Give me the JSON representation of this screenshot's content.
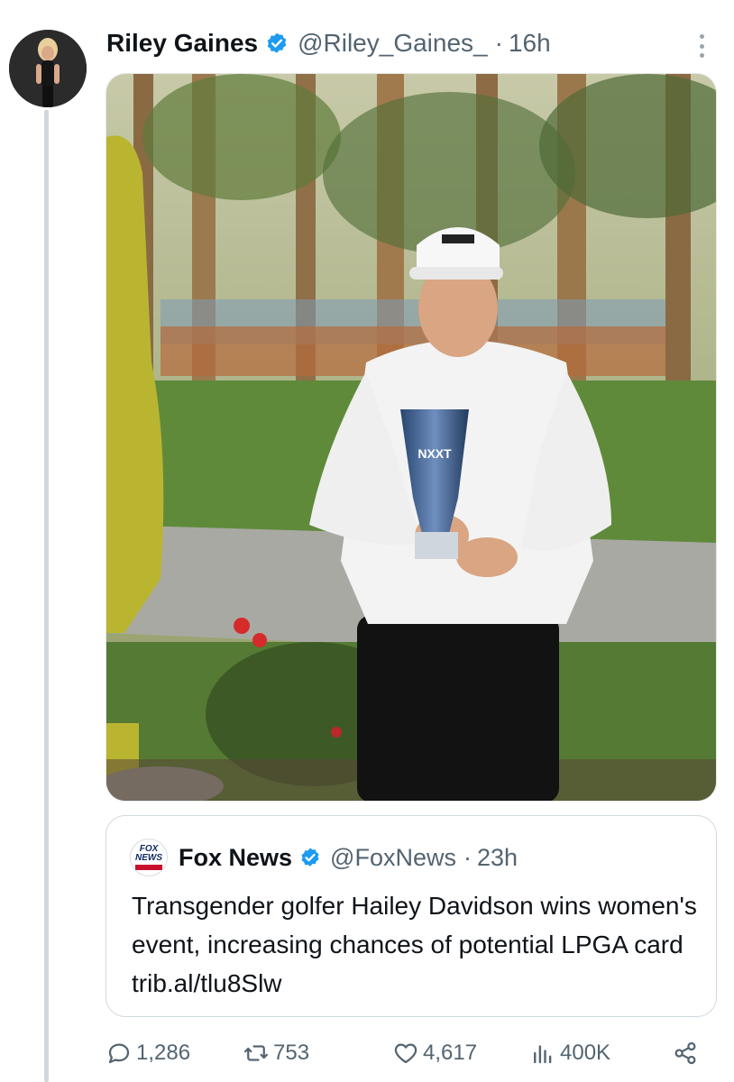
{
  "tweet": {
    "display_name": "Riley Gaines",
    "handle": "@Riley_Gaines_",
    "separator": "·",
    "time": "16h",
    "verified_icon": "verified-badge-icon",
    "more_icon": "more-dots-icon",
    "media_alt": "photo"
  },
  "quote": {
    "logo_line1": "FOX",
    "logo_line2": "NEWS",
    "name": "Fox News",
    "handle": "@FoxNews",
    "separator": "·",
    "time": "23h",
    "text": "Transgender golfer Hailey Davidson wins women's event, increasing chances of potential LPGA card trib.al/tlu8Slw"
  },
  "actions": {
    "replies": "1,286",
    "retweets": "753",
    "likes": "4,617",
    "views": "400K",
    "icons": [
      "reply-icon",
      "retweet-icon",
      "like-icon",
      "views-icon",
      "share-icon"
    ]
  },
  "colors": {
    "verified": "#1d9bf0",
    "muted": "#536471",
    "border": "#cfd9de"
  }
}
